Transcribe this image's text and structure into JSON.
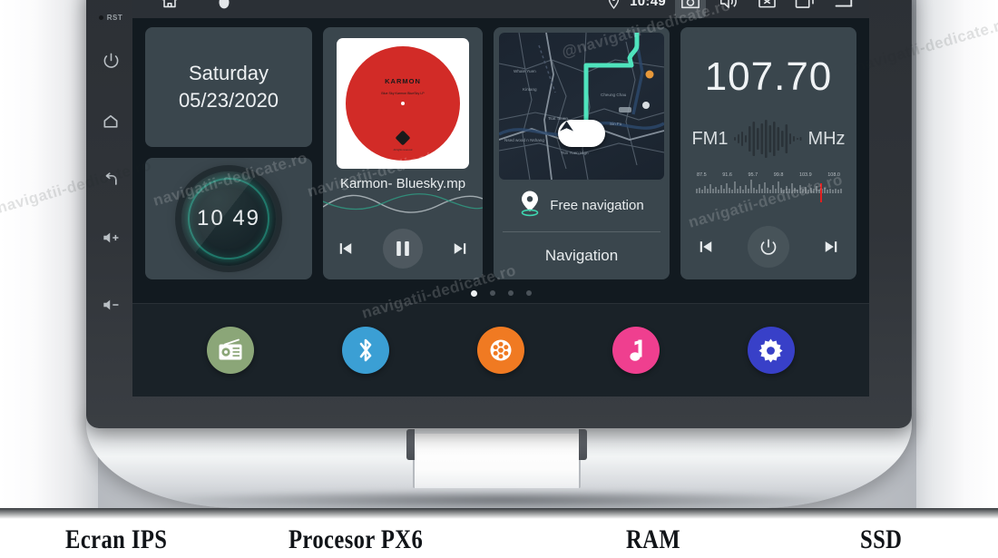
{
  "device": {
    "bezel_keys": [
      {
        "name": "reset",
        "label": "RST",
        "icon": "reset-pinhole-icon"
      },
      {
        "name": "power",
        "label": "",
        "icon": "power-icon"
      },
      {
        "name": "home",
        "label": "",
        "icon": "home-icon"
      },
      {
        "name": "back",
        "label": "",
        "icon": "back-arrow-icon"
      },
      {
        "name": "volume-up",
        "label": "",
        "icon": "volume-up-icon"
      },
      {
        "name": "volume-down",
        "label": "",
        "icon": "volume-down-icon"
      }
    ]
  },
  "statusbar": {
    "left_icons": [
      {
        "name": "home-icon",
        "label": "home"
      },
      {
        "name": "shield-icon",
        "label": "shield"
      }
    ],
    "location_icon": "location-pin-icon",
    "time": "10:49",
    "right_icons": [
      {
        "name": "camera-icon",
        "label": "camera",
        "active": true
      },
      {
        "name": "volume-icon",
        "label": "volume",
        "active": false
      },
      {
        "name": "close-box-icon",
        "label": "close",
        "active": false
      },
      {
        "name": "recent-apps-icon",
        "label": "recent apps",
        "active": false
      },
      {
        "name": "back-arrow-icon",
        "label": "back",
        "active": false
      }
    ]
  },
  "widgets": {
    "date": {
      "weekday": "Saturday",
      "date": "05/23/2020"
    },
    "clock": {
      "time": "10 49",
      "ring_color": "#28bea0"
    },
    "music": {
      "album_brand": "KARMON",
      "album_sub": "Blue Sky\nKarmon\nBlueSky LP",
      "album_footer": "All rights reserved",
      "album_color": "#d22b27",
      "track": "Karmon- Bluesky.mp",
      "controls": [
        {
          "name": "previous-track-button",
          "icon": "skip-previous-icon"
        },
        {
          "name": "play-pause-button",
          "icon": "pause-icon"
        },
        {
          "name": "next-track-button",
          "icon": "skip-next-icon"
        }
      ]
    },
    "navigation": {
      "map_labels": [
        "Whale Yuen",
        "Kintang",
        "Tsat Tsuen",
        "Cheung Chau",
        "Sin Fu",
        "Nsed wood n Nshang",
        "Tsin Yuen Hign"
      ],
      "route_color": "#4fe3bd",
      "free_nav_label": "Free navigation",
      "title": "Navigation",
      "pin_icon": "location-pin-icon"
    },
    "radio": {
      "frequency": "107.70",
      "band": "FM1",
      "unit": "MHz",
      "scale_labels": [
        "87.5",
        "91.6",
        "95.7",
        "99.8",
        "103.9",
        "108.0"
      ],
      "needle_color": "#e02020",
      "controls": [
        {
          "name": "previous-station-button",
          "icon": "skip-previous-icon"
        },
        {
          "name": "power-button",
          "icon": "power-icon"
        },
        {
          "name": "next-station-button",
          "icon": "skip-next-icon"
        }
      ]
    }
  },
  "pager": {
    "count": 4,
    "active_index": 0
  },
  "dock": {
    "items": [
      {
        "name": "dock-item-radio",
        "icon": "radio-icon",
        "label": "Radio",
        "color": "#8ba678"
      },
      {
        "name": "dock-item-bluetooth",
        "icon": "bluetooth-icon",
        "label": "Bluetooth",
        "color": "#3b9fd4"
      },
      {
        "name": "dock-item-video",
        "icon": "film-reel-icon",
        "label": "Video",
        "color": "#f07a22"
      },
      {
        "name": "dock-item-music",
        "icon": "music-note-icon",
        "label": "Music",
        "color": "#ef3f8f"
      },
      {
        "name": "dock-item-settings",
        "icon": "gear-icon",
        "label": "Settings",
        "color": "#3840c8"
      }
    ]
  },
  "watermarks": [
    "navigatii-dedicate.ro",
    "@navigatii-dedicate.ro",
    "navigatii-dedicate.ro",
    "navigatii-dedicate.ro",
    "navigatii-dedicate.ro",
    "navigatii-dedicate.ro",
    "navigatii-dedicate.ro"
  ],
  "spec_banner": {
    "items": [
      "Ecran IPS",
      "Procesor PX6",
      "RAM",
      "SSD"
    ]
  }
}
